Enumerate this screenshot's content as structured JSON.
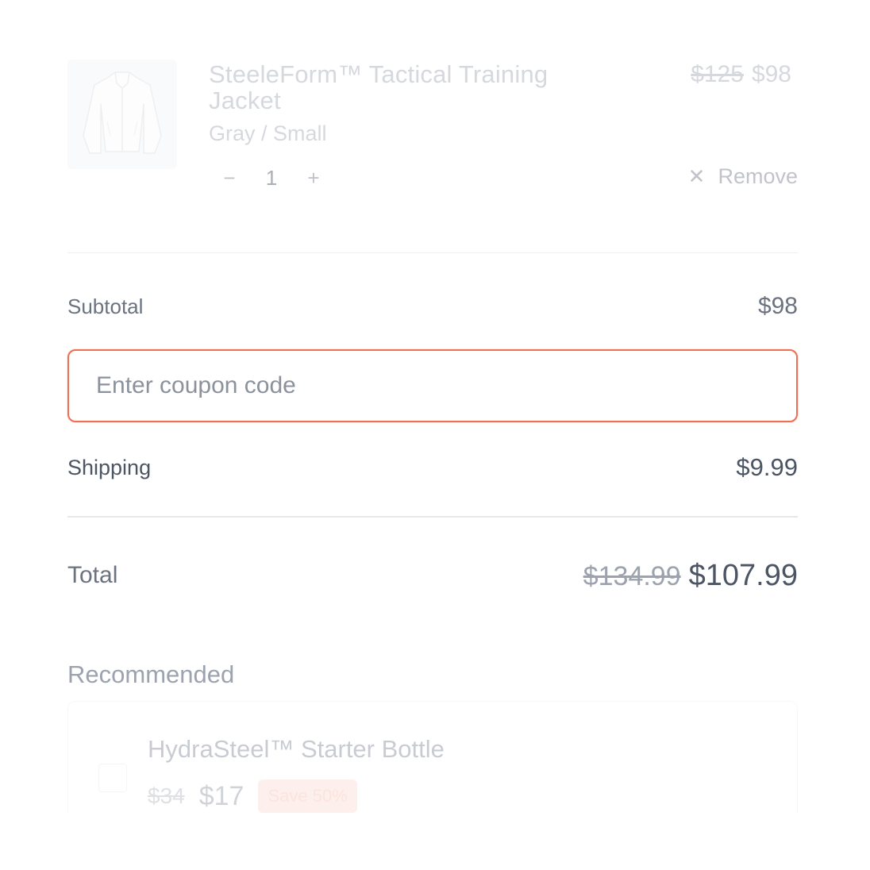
{
  "cart_item": {
    "title": "SteeleForm™ Tactical Training Jacket",
    "variant": "Gray / Small",
    "price_original": "$125",
    "price_sale": "$98",
    "quantity": "1",
    "decrement_symbol": "−",
    "increment_symbol": "+",
    "remove_label": "Remove",
    "remove_icon": "close-icon",
    "image": "gray-jacket-thumbnail"
  },
  "summary": {
    "subtotal_label": "Subtotal",
    "subtotal_value": "$98",
    "coupon_placeholder": "Enter coupon code",
    "coupon_value": "",
    "shipping_label": "Shipping",
    "shipping_value": "$9.99",
    "total_label": "Total",
    "total_original": "$134.99",
    "total_value": "$107.99"
  },
  "recommended": {
    "heading": "Recommended",
    "items": [
      {
        "title": "HydraSteel™ Starter Bottle",
        "price_original": "$34",
        "price_sale": "$17",
        "badge": "Save 50%"
      }
    ]
  },
  "colors": {
    "coupon_focus_border": "#ef6f52",
    "badge_background": "#fde2dc"
  }
}
